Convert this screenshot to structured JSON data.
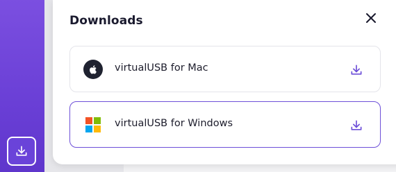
{
  "popover": {
    "title": "Downloads",
    "close_icon": "close-icon"
  },
  "options": [
    {
      "os": "mac",
      "label": "virtualUSB for Mac",
      "icon": "apple-icon",
      "action_icon": "download-icon"
    },
    {
      "os": "windows",
      "label": "virtualUSB for Windows",
      "icon": "windows-icon",
      "action_icon": "download-icon",
      "selected": true
    }
  ],
  "sidebar": {
    "download_button_icon": "download-icon"
  },
  "colors": {
    "accent": "#6d4fd8",
    "rail": "#6a3fd6",
    "win_red": "#f35325",
    "win_green": "#81bc06",
    "win_blue": "#05a6f0",
    "win_yellow": "#ffba08"
  }
}
